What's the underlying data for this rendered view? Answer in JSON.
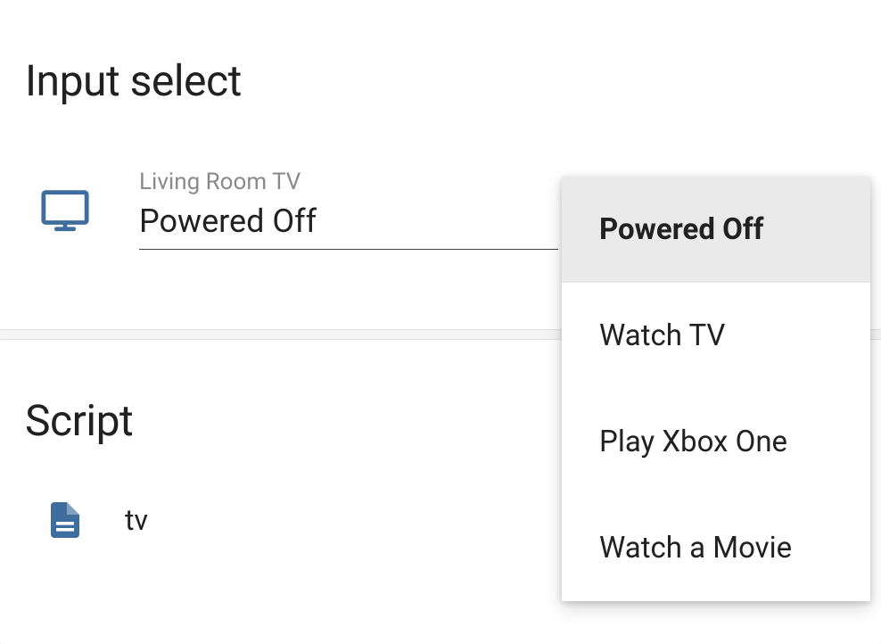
{
  "input_select": {
    "section_title": "Input select",
    "entity": {
      "label": "Living Room TV",
      "selected": "Powered Off"
    },
    "options": [
      {
        "label": "Powered Off",
        "selected": true
      },
      {
        "label": "Watch TV",
        "selected": false
      },
      {
        "label": "Play Xbox One",
        "selected": false
      },
      {
        "label": "Watch a Movie",
        "selected": false
      }
    ]
  },
  "script": {
    "section_title": "Script",
    "items": [
      {
        "name": "tv"
      }
    ]
  },
  "colors": {
    "icon": "#3f6d9e"
  }
}
